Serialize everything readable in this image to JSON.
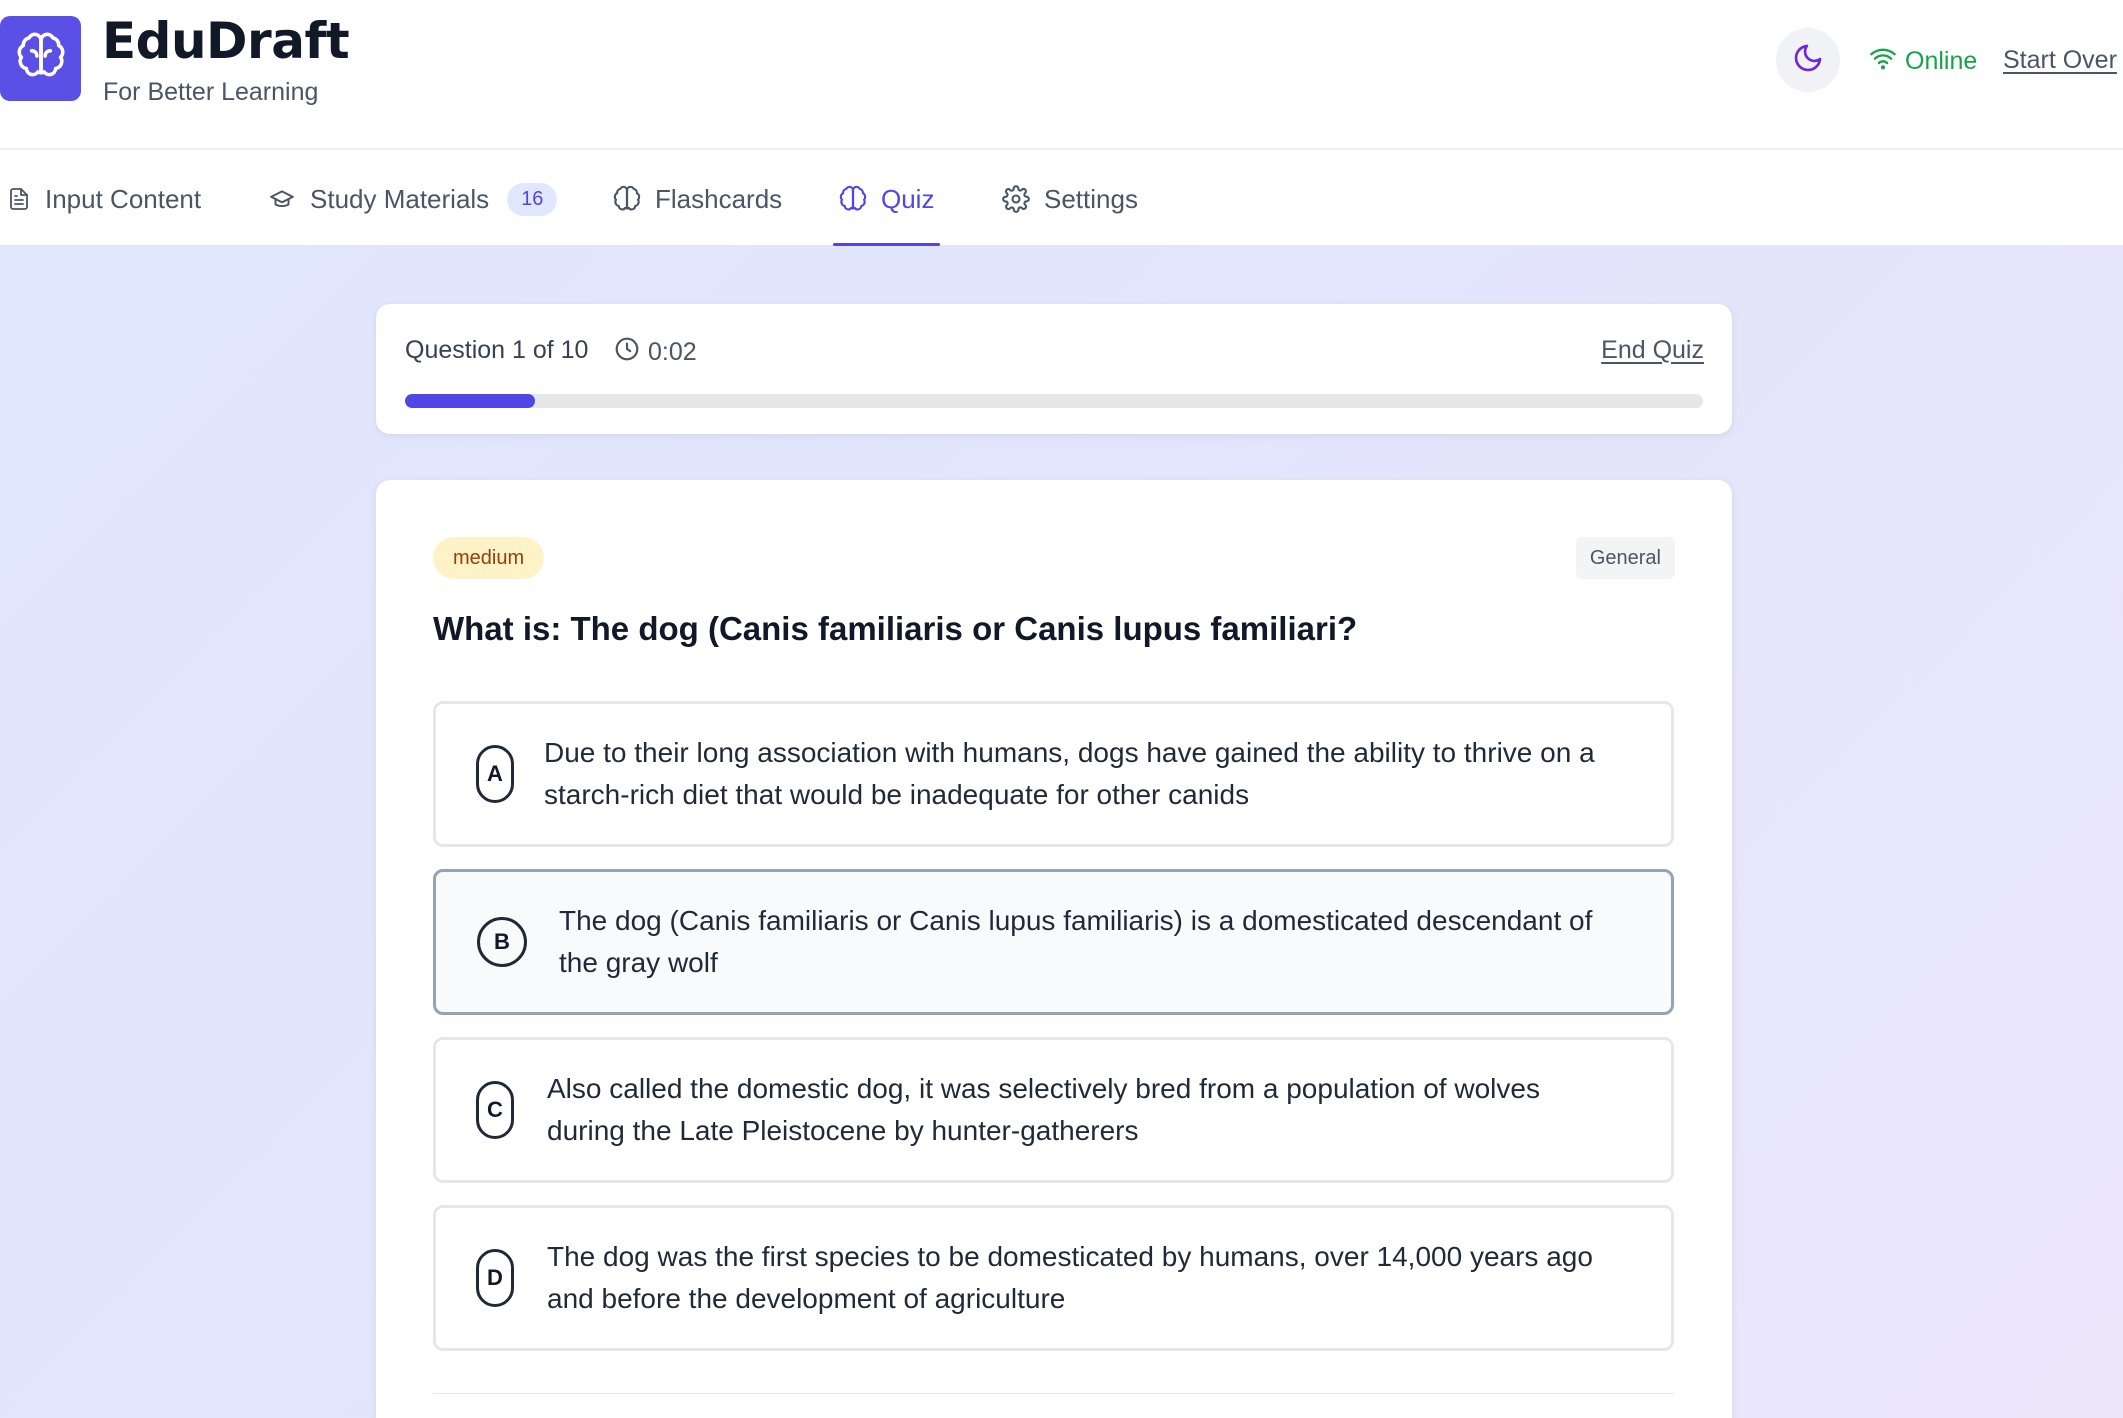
{
  "app": {
    "title": "EduDraft",
    "subtitle": "For Better Learning",
    "logo_icon": "brain-icon",
    "brand_color": "#5b50e6"
  },
  "header": {
    "theme_icon": "moon-icon",
    "status_label": "Online",
    "status_color": "#16a34a",
    "start_over_label": "Start Over"
  },
  "tabs": [
    {
      "label": "Input Content",
      "icon": "file-text-icon",
      "active": false
    },
    {
      "label": "Study Materials",
      "icon": "graduation-cap-icon",
      "badge": "16",
      "active": false
    },
    {
      "label": "Flashcards",
      "icon": "brain-icon",
      "active": false
    },
    {
      "label": "Quiz",
      "icon": "brain-icon",
      "active": true
    },
    {
      "label": "Settings",
      "icon": "gear-icon",
      "active": false
    }
  ],
  "quiz": {
    "counter": "Question 1 of 10",
    "timer": "0:02",
    "end_label": "End Quiz",
    "progress_fraction": 0.1,
    "accent_color": "#4f46e5"
  },
  "question": {
    "difficulty": "medium",
    "category": "General",
    "text": "What is: The dog (Canis familiaris or Canis lupus familiari?",
    "options": [
      {
        "letter": "A",
        "text": "Due to their long association with humans, dogs have gained the ability to thrive on a starch-rich diet that would be inadequate for other canids"
      },
      {
        "letter": "B",
        "text": "The dog (Canis familiaris or Canis lupus familiaris) is a domesticated descendant of the gray wolf",
        "hovered": true
      },
      {
        "letter": "C",
        "text": "Also called the domestic dog, it was selectively bred from a population of wolves during the Late Pleistocene by hunter-gatherers"
      },
      {
        "letter": "D",
        "text": "The dog was the first species to be domesticated by humans, over 14,000 years ago and before the development of agriculture"
      }
    ]
  }
}
